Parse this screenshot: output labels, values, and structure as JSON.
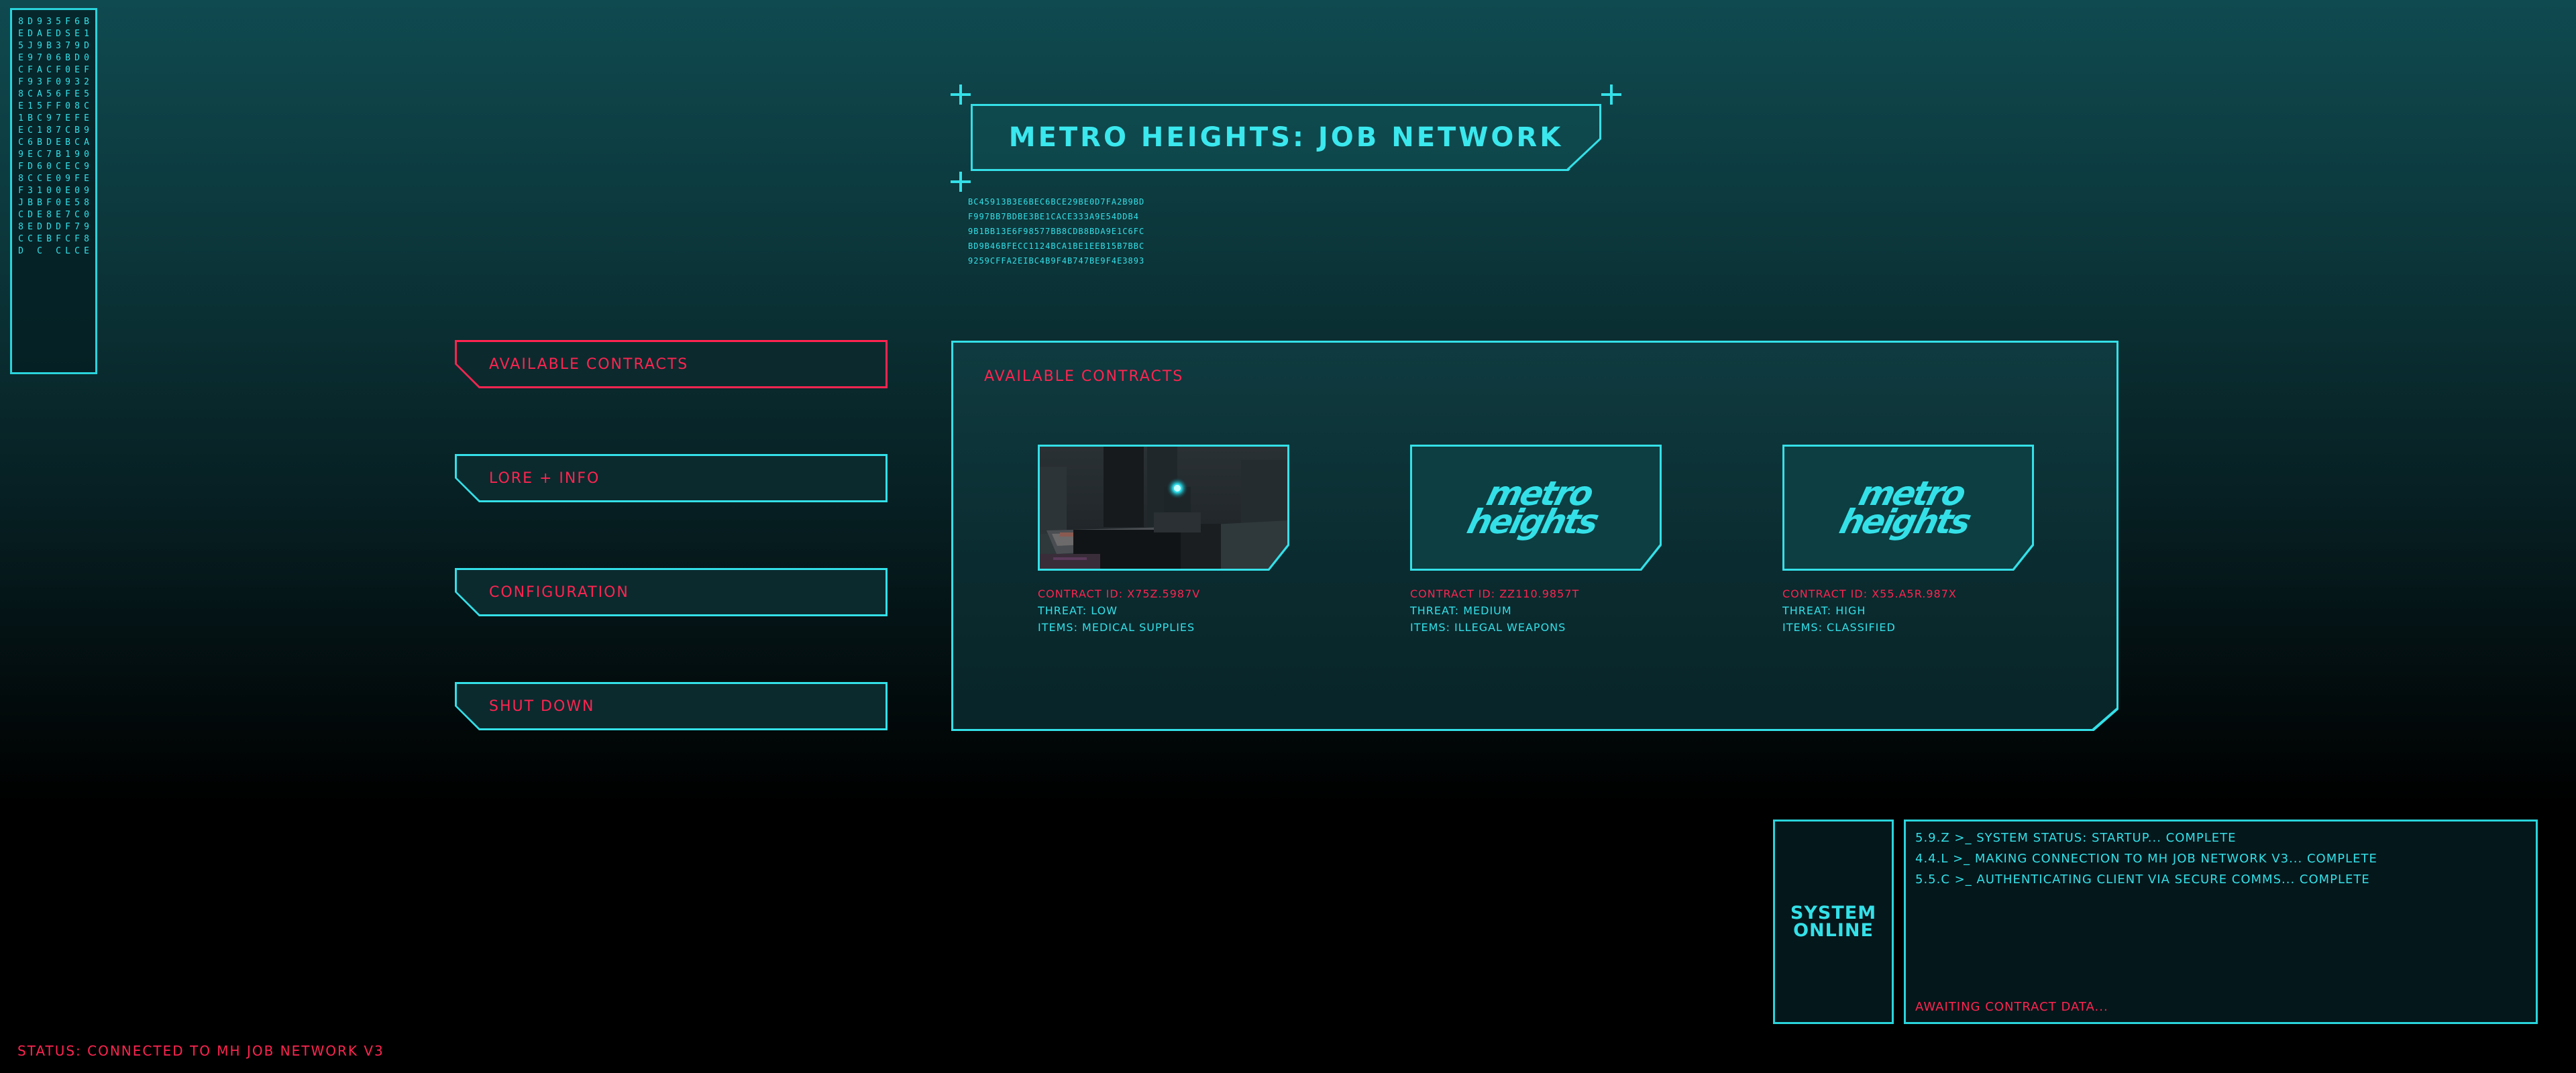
{
  "colors": {
    "accent_cyan": "#34e0e8",
    "accent_red": "#ff2450",
    "bg_top": "#0f4a50",
    "bg_bottom": "#000000"
  },
  "hex_columns": [
    "8E5ECF8E1EC9F8FJC8CD",
    "DDJ9F9C1BC6EDC3BDEC",
    "9A97A3A5C1BC6C1BEDEC",
    "3EB0CF5F98D70E0F8DB",
    "5D36F06F77EBC000EDFC",
    "FS7B09F0ECB1E9EE7FCL",
    "6E9DE3E8FBC9CF05C7FC",
    "B1D0F25CE9A09E98098E"
  ],
  "title": "METRO HEIGHTS: JOB NETWORK",
  "hex_lines": [
    "BC45913B3E6BEC6BCE29BE0D7FA2B9BD",
    "F997BB7BDBE3BE1CACE333A9E54DDB4",
    "9B1BB13E6F98577BB8CDB8BDA9E1C6FC",
    "BD9B46BFECC1124BCA1BE1EEB15B7BBC",
    "9259CFFA2EIBC4B9F4B747BE9F4E3893"
  ],
  "menu": [
    {
      "label": "AVAILABLE CONTRACTS",
      "active": true
    },
    {
      "label": "LORE + INFO",
      "active": false
    },
    {
      "label": "CONFIGURATION",
      "active": false
    },
    {
      "label": "SHUT DOWN",
      "active": false
    }
  ],
  "panel": {
    "title": "AVAILABLE CONTRACTS",
    "contracts": [
      {
        "image": "screenshot",
        "contract_id": "CONTRACT ID: X75Z.5987V",
        "threat": "THREAT: LOW",
        "items": "ITEMS: MEDICAL SUPPLIES"
      },
      {
        "image": "metro-heights-logo",
        "logo_text_1": "metro",
        "logo_text_2": "heights",
        "contract_id": "CONTRACT ID: ZZ110.9857T",
        "threat": "THREAT: MEDIUM",
        "items": "ITEMS: ILLEGAL WEAPONS"
      },
      {
        "image": "metro-heights-logo",
        "logo_text_1": "metro",
        "logo_text_2": "heights",
        "contract_id": "CONTRACT ID: X55.A5R.987X",
        "threat": "THREAT: HIGH",
        "items": "ITEMS: CLASSIFIED"
      }
    ]
  },
  "system": {
    "online_line1": "SYSTEM",
    "online_line2": "ONLINE",
    "log": [
      "5.9.Z >_ SYSTEM STATUS: STARTUP... COMPLETE",
      "4.4.L >_ MAKING CONNECTION TO MH JOB NETWORK V3... COMPLETE",
      "5.5.C >_ AUTHENTICATING CLIENT VIA SECURE COMMS... COMPLETE"
    ],
    "waiting": "AWAITING CONTRACT DATA..."
  },
  "status": "STATUS: CONNECTED TO MH JOB NETWORK V3"
}
